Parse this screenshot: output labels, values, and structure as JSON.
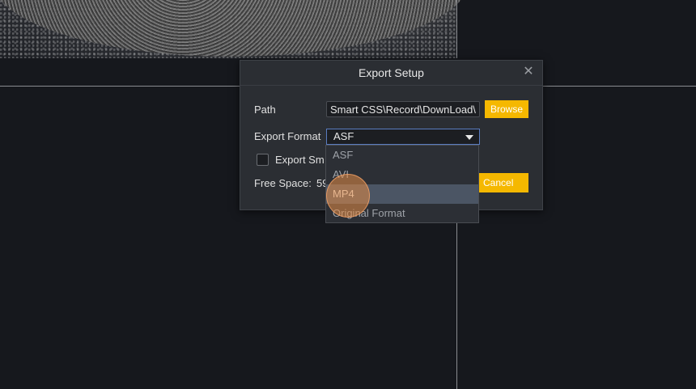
{
  "dialog": {
    "title": "Export Setup",
    "close_icon": "close-icon",
    "path_label": "Path",
    "path_value": "Smart CSS\\Record\\DownLoad\\",
    "browse_label": "Browse",
    "format_label": "Export Format",
    "format_value": "ASF",
    "export_smart_label": "Export Sm",
    "free_space_label": "Free Space:",
    "free_space_value": "59",
    "cancel_label": "Cancel"
  },
  "dropdown": {
    "options": [
      "ASF",
      "AVI",
      "MP4",
      "Original Format"
    ],
    "highlighted": "MP4"
  },
  "colors": {
    "accent": "#f5b800",
    "background": "#16181d",
    "dialog": "#2b2e33",
    "highlight": "#4b5564"
  }
}
